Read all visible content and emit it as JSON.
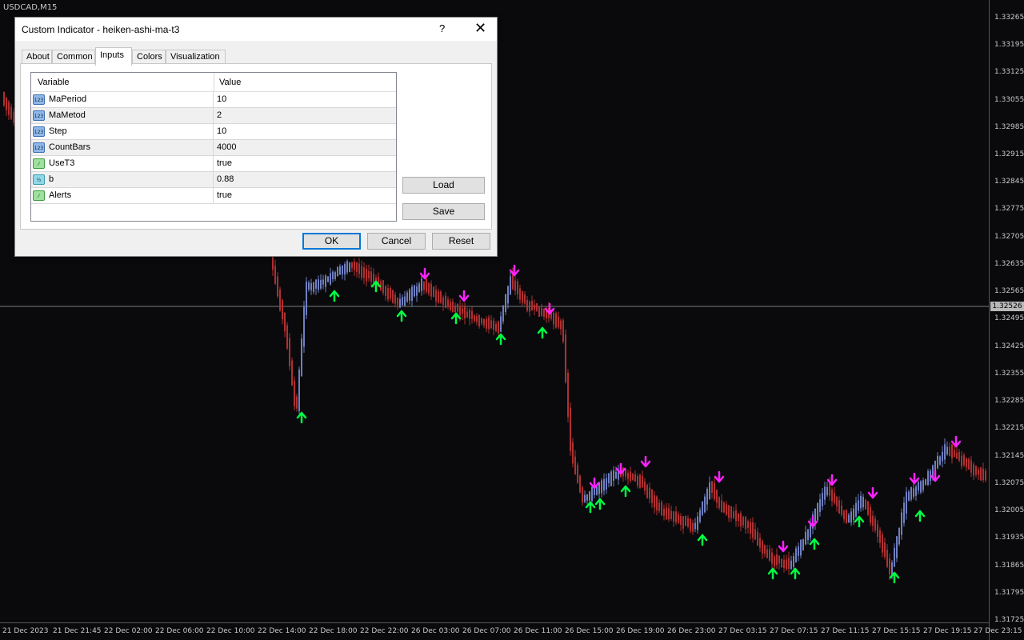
{
  "chart": {
    "symbol": "USDCAD,M15",
    "price_ticks": [
      "1.33265",
      "1.33195",
      "1.33125",
      "1.33055",
      "1.32985",
      "1.32915",
      "1.32845",
      "1.32775",
      "1.32705",
      "1.32635",
      "1.32565",
      "1.32495",
      "1.32425",
      "1.32355",
      "1.32285",
      "1.32215",
      "1.32145",
      "1.32075",
      "1.32005",
      "1.31935",
      "1.31865",
      "1.31795",
      "1.31725"
    ],
    "current_price": "1.32526",
    "time_ticks": [
      "21 Dec 2023",
      "21 Dec 21:45",
      "22 Dec 02:00",
      "22 Dec 06:00",
      "22 Dec 10:00",
      "22 Dec 14:00",
      "22 Dec 18:00",
      "22 Dec 22:00",
      "26 Dec 03:00",
      "26 Dec 07:00",
      "26 Dec 11:00",
      "26 Dec 15:00",
      "26 Dec 19:00",
      "26 Dec 23:00",
      "27 Dec 03:15",
      "27 Dec 07:15",
      "27 Dec 11:15",
      "27 Dec 15:15",
      "27 Dec 19:15",
      "27 Dec 23:15"
    ],
    "colors": {
      "background": "#0a0a0d",
      "bull_candle": "#6f7fc0",
      "bear_candle": "#b03030",
      "up_arrow": "#00ff44",
      "down_arrow": "#ff22ff",
      "current_price_line": "#7a7a7a"
    }
  },
  "dialog": {
    "title": "Custom Indicator - heiken-ashi-ma-t3",
    "help_label": "?",
    "close_label": "✕",
    "tabs": [
      {
        "label": "About"
      },
      {
        "label": "Common"
      },
      {
        "label": "Inputs"
      },
      {
        "label": "Colors"
      },
      {
        "label": "Visualization"
      }
    ],
    "active_tab": "Inputs",
    "grid": {
      "col_variable": "Variable",
      "col_value": "Value",
      "rows": [
        {
          "name": "MaPeriod",
          "value": "10",
          "icon": "int-icon"
        },
        {
          "name": "MaMetod",
          "value": "2",
          "icon": "int-icon"
        },
        {
          "name": "Step",
          "value": "10",
          "icon": "int-icon"
        },
        {
          "name": "CountBars",
          "value": "4000",
          "icon": "int-icon"
        },
        {
          "name": "UseT3",
          "value": "true",
          "icon": "bool-icon"
        },
        {
          "name": "b",
          "value": "0.88",
          "icon": "double-icon"
        },
        {
          "name": "Alerts",
          "value": "true",
          "icon": "bool-icon"
        }
      ]
    },
    "buttons": {
      "load": "Load",
      "save": "Save",
      "ok": "OK",
      "cancel": "Cancel",
      "reset": "Reset"
    }
  }
}
